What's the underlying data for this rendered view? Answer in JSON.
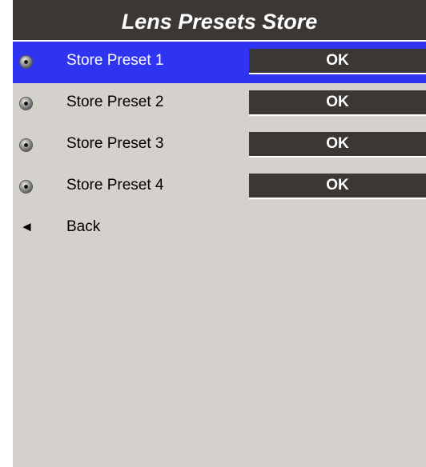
{
  "menu": {
    "title": "Lens Presets Store",
    "items": [
      {
        "label": "Store Preset 1",
        "button": "OK",
        "icon": "lens-icon",
        "selected": true
      },
      {
        "label": "Store Preset 2",
        "button": "OK",
        "icon": "lens-icon",
        "selected": false
      },
      {
        "label": "Store Preset 3",
        "button": "OK",
        "icon": "lens-icon",
        "selected": false
      },
      {
        "label": "Store Preset 4",
        "button": "OK",
        "icon": "lens-icon",
        "selected": false
      }
    ],
    "back": {
      "label": "Back",
      "icon": "back-arrow-icon",
      "glyph": "◄"
    }
  },
  "colors": {
    "background": "#d4d0cc",
    "title_bar": "#3b3735",
    "selection": "#2f34f0",
    "button": "#3b3735"
  }
}
